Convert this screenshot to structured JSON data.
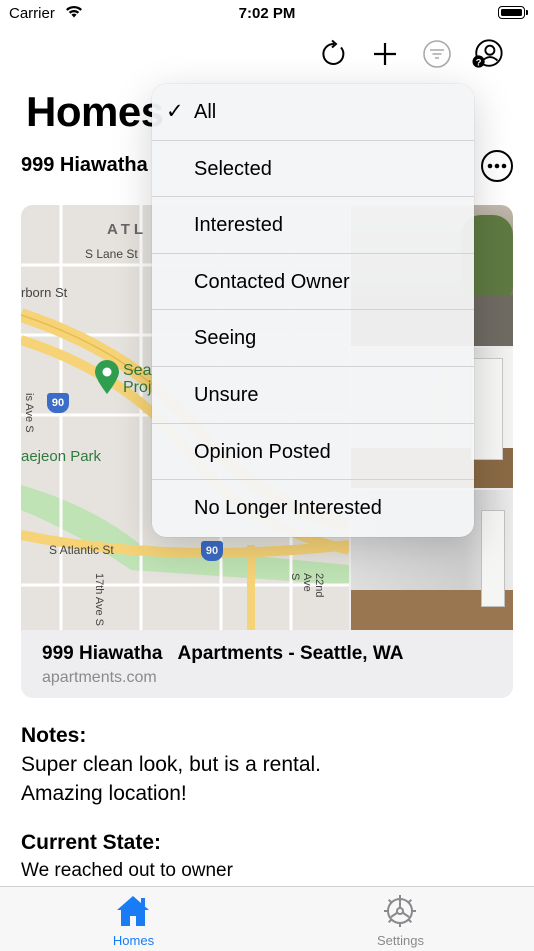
{
  "status_bar": {
    "carrier": "Carrier",
    "time": "7:02 PM"
  },
  "toolbar": {
    "icons": [
      "refresh-icon",
      "plus-icon",
      "filter-icon",
      "account-icon"
    ]
  },
  "page": {
    "title": "Homes",
    "subtitle": "999 Hiawatha"
  },
  "card": {
    "title": "999 Hiawatha   Apartments - Seattle, WA",
    "source": "apartments.com",
    "map_labels": {
      "atl": "ATL",
      "s_lane": "S Lane St",
      "dearborn": "rborn St",
      "sea": "Sea",
      "proj": "Proj",
      "daejeon": "aejeon Park",
      "atlantic": "S Atlantic St",
      "ave17": "17th Ave S",
      "ave22": "22nd Ave S",
      "aves": "is Ave S",
      "i90a": "90",
      "i90b": "90"
    }
  },
  "notes": {
    "heading": "Notes:",
    "line1": "Super clean look, but is a rental.",
    "line2": "Amazing location!"
  },
  "state": {
    "heading": "Current State:",
    "value": "We reached out to owner"
  },
  "tabs": [
    {
      "label": "Homes",
      "icon": "house-icon",
      "active": true,
      "color": "#1a7cf5"
    },
    {
      "label": "Settings",
      "icon": "gear-icon",
      "active": false,
      "color": "#8a8a8e"
    }
  ],
  "menu": {
    "check": "✓",
    "items": [
      {
        "label": "All",
        "checked": true
      },
      {
        "label": "Selected"
      },
      {
        "label": "Interested"
      },
      {
        "label": "Contacted Owner"
      },
      {
        "label": "Seeing"
      },
      {
        "label": "Unsure"
      },
      {
        "label": "Opinion Posted"
      },
      {
        "label": "No Longer Interested"
      }
    ]
  },
  "colors": {
    "accent": "#1a7cf5",
    "map_pin": "#2f9e4f"
  }
}
